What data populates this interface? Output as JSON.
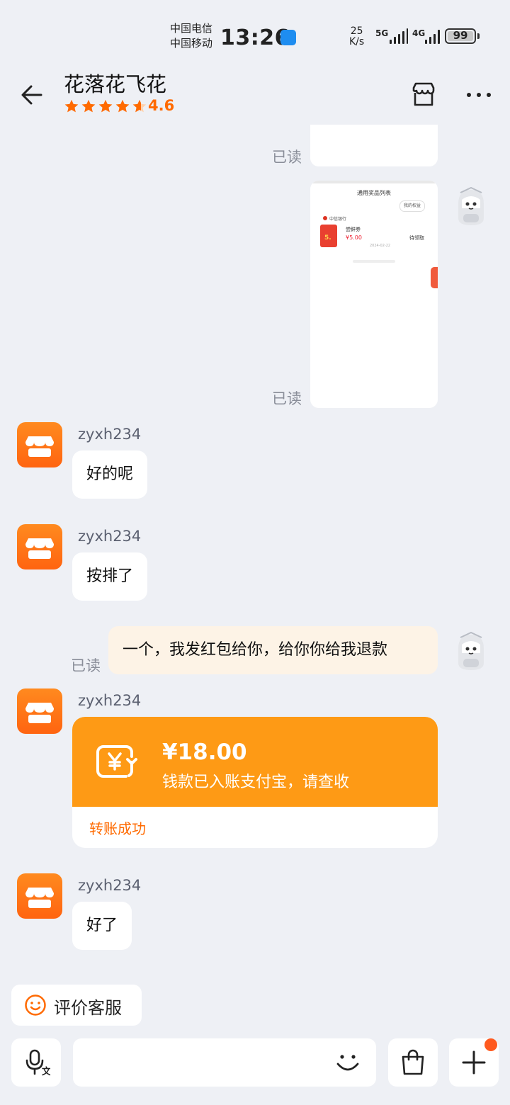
{
  "status_bar": {
    "carrier1": "中国电信",
    "carrier2": "中国移动",
    "time": "13:26",
    "speed_value": "25",
    "speed_unit": "K/s",
    "net1": "5G",
    "net2": "4G",
    "battery": "99"
  },
  "header": {
    "title": "花落花飞花",
    "rating": "4.6",
    "rating_stars": 4.6
  },
  "chat": {
    "read_label": "已读",
    "img_preview": {
      "title": "通用奖品列表",
      "rights": "我的权益",
      "bank": "中信银行",
      "item_name": "尝鲜券",
      "item_price": "¥5.00",
      "item_status": "待领取",
      "item_date": "2024-02-22",
      "badge": "5."
    },
    "messages": [
      {
        "sender": "zyxh234",
        "text": "好的呢"
      },
      {
        "sender": "zyxh234",
        "text": "按排了"
      },
      {
        "sender": "me",
        "text": "一个，我发红包给你，给你你给我退款"
      },
      {
        "sender": "zyxh234",
        "text": "好了"
      }
    ],
    "transfer": {
      "sender": "zyxh234",
      "amount": "¥18.00",
      "desc": "钱款已入账支付宝，请查收",
      "status": "转账成功"
    }
  },
  "bottom": {
    "rate_label": "评价客服"
  },
  "colors": {
    "accent": "#ff6a00",
    "transfer": "#fe9a15",
    "background": "#eef0f5"
  }
}
